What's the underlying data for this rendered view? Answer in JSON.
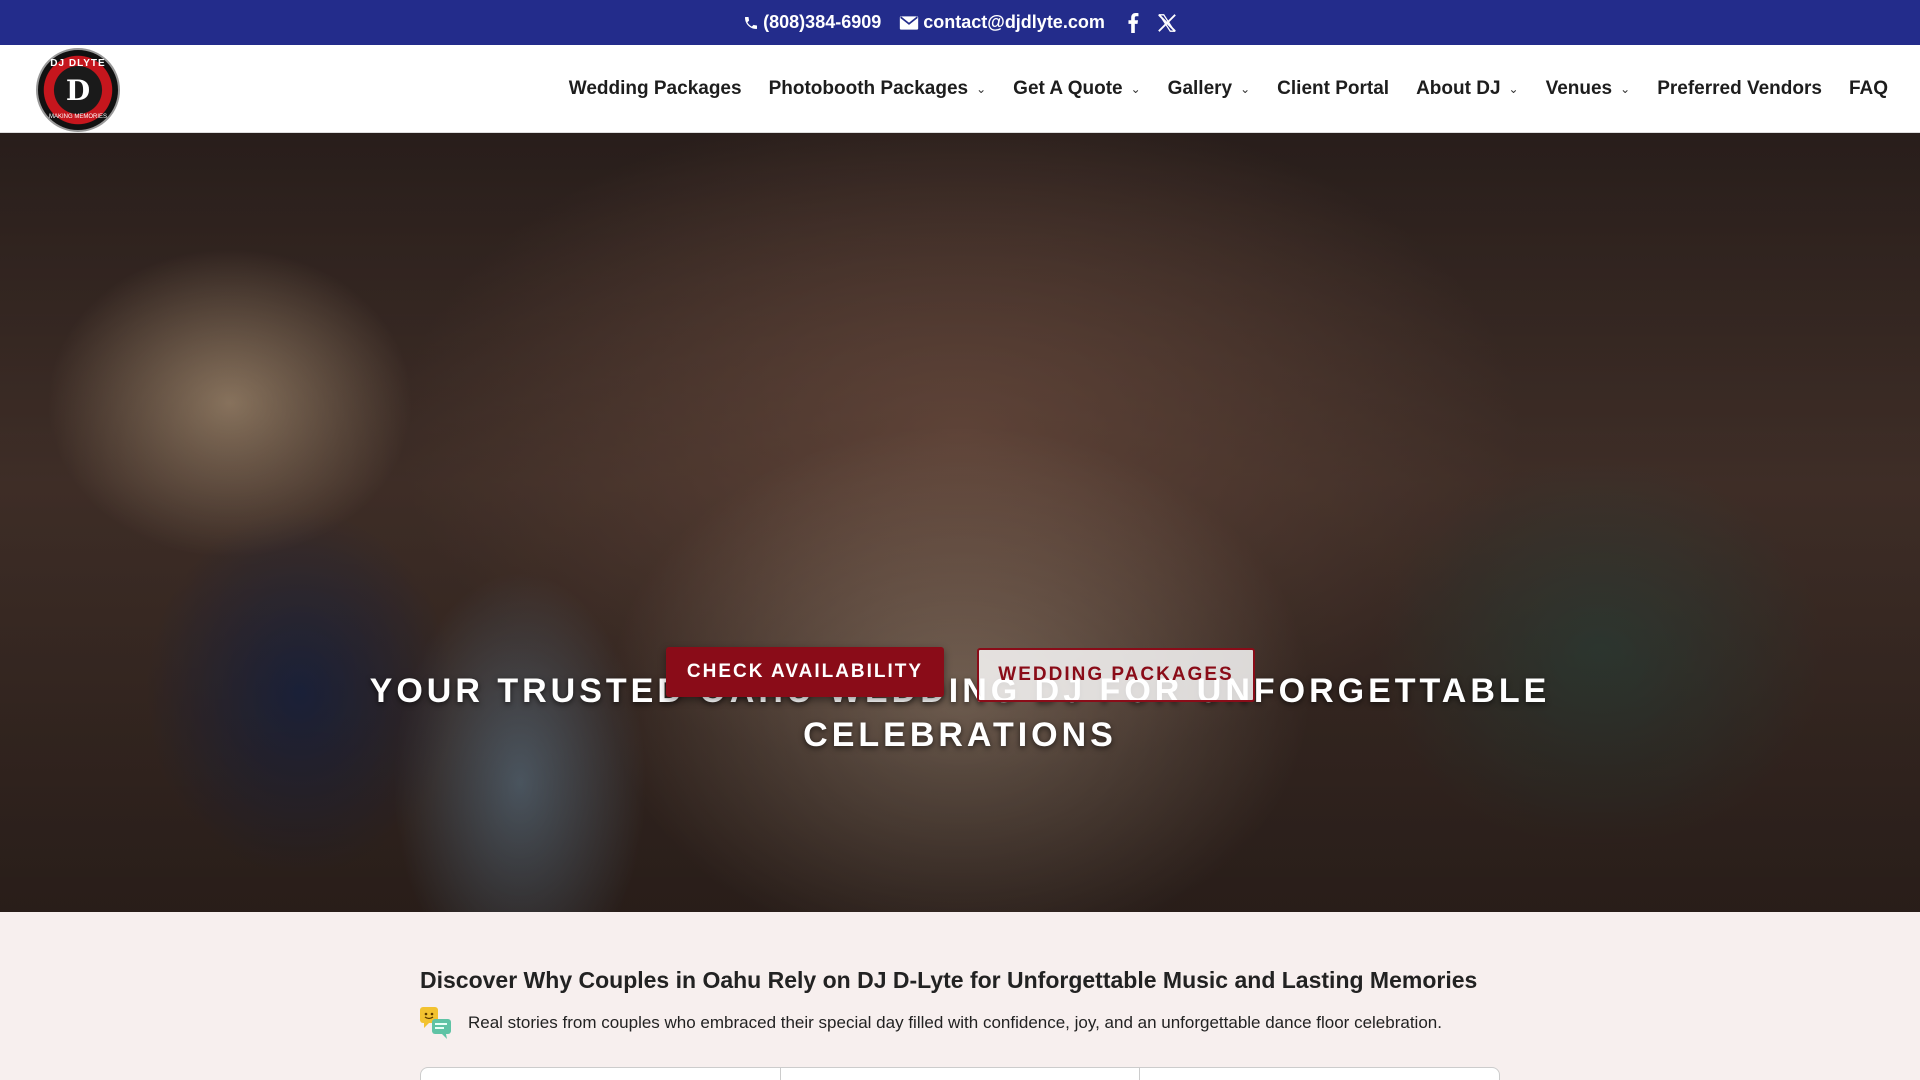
{
  "topbar": {
    "phone": "(808)384-6909",
    "email": "contact@djdlyte.com",
    "icons": [
      "phone-icon",
      "mail-icon",
      "facebook-icon",
      "x-icon"
    ],
    "background": "#232c8b"
  },
  "header": {
    "logo": {
      "top_text": "DJ DLYTE",
      "mark": "D",
      "bottom_text": "MAKING MEMORIES"
    },
    "nav": [
      {
        "label": "Wedding Packages",
        "dropdown": false
      },
      {
        "label": "Photobooth Packages",
        "dropdown": true
      },
      {
        "label": "Get A Quote",
        "dropdown": true
      },
      {
        "label": "Gallery",
        "dropdown": true
      },
      {
        "label": "Client Portal",
        "dropdown": false
      },
      {
        "label": "About DJ",
        "dropdown": true
      },
      {
        "label": "Venues",
        "dropdown": true
      },
      {
        "label": "Preferred Vendors",
        "dropdown": false
      },
      {
        "label": "FAQ",
        "dropdown": false
      }
    ]
  },
  "hero": {
    "title": "YOUR TRUSTED OAHU WEDDING DJ FOR UNFORGETTABLE CELEBRATIONS",
    "primary_button": "CHECK AVAILABILITY",
    "secondary_button": "WEDDING PACKAGES",
    "accent": "#8a0c18"
  },
  "section": {
    "heading": "Discover Why Couples in Oahu Rely on DJ D-Lyte for Unforgettable Music and Lasting Memories",
    "subtext": "Real stories from couples who embraced their special day filled with confidence, joy, and an unforgettable dance floor celebration.",
    "icon": "chat-bubbles-icon"
  }
}
